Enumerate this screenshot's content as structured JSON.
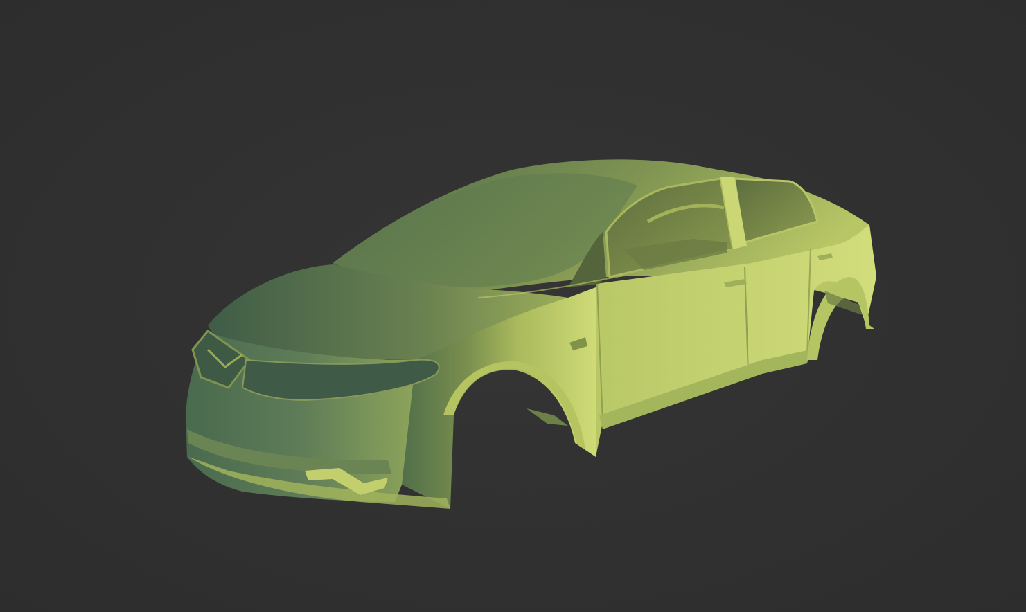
{
  "viewport": {
    "background_color": "#303030",
    "model_color_light": "#d4e07a",
    "model_color_mid": "#a8b85a",
    "model_color_dark": "#4c6a48"
  },
  "model": {
    "object": "car-body-shell",
    "icon": "sedan-shell"
  }
}
